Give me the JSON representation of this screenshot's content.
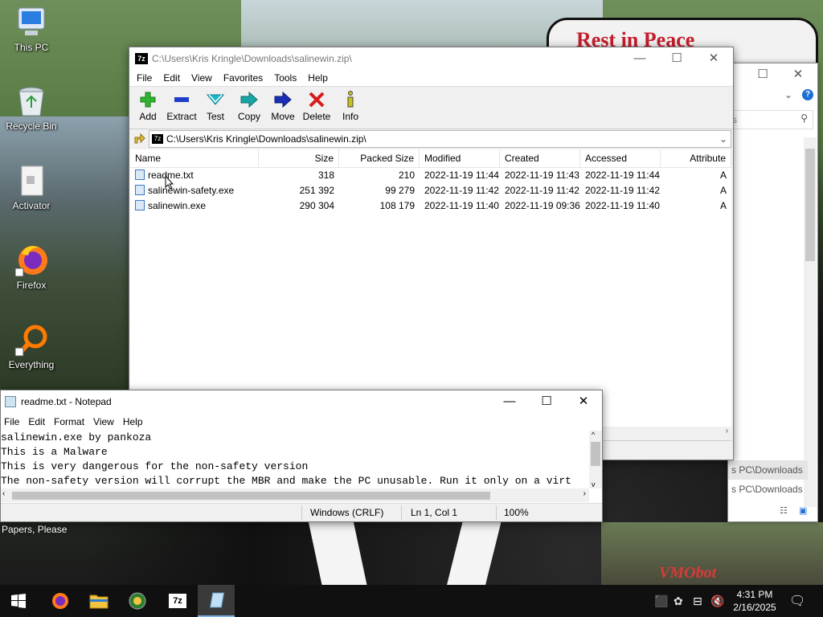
{
  "desktop": {
    "sign_text": "Rest in Peace",
    "wallpaper_mark": "VMObot",
    "icons": [
      {
        "label": "This PC",
        "icon": "this-pc-icon"
      },
      {
        "label": "Recycle Bin",
        "icon": "recycle-bin-icon"
      },
      {
        "label": "Activator",
        "icon": "activator-icon"
      },
      {
        "label": "Firefox",
        "icon": "firefox-icon"
      },
      {
        "label": "Everything",
        "icon": "everything-icon"
      }
    ],
    "papers_label": "Papers, Please"
  },
  "explorer": {
    "rows": [
      "s PC\\Downloads",
      "s PC\\Downloads"
    ],
    "search_placeholder": "s"
  },
  "zip": {
    "title": "C:\\Users\\Kris Kringle\\Downloads\\salinewin.zip\\",
    "menu": [
      "File",
      "Edit",
      "View",
      "Favorites",
      "Tools",
      "Help"
    ],
    "toolbar": [
      {
        "label": "Add",
        "icon": "add-icon",
        "color": "#2db52d"
      },
      {
        "label": "Extract",
        "icon": "extract-icon",
        "color": "#1e3ec9"
      },
      {
        "label": "Test",
        "icon": "test-icon",
        "color": "#19b7c7"
      },
      {
        "label": "Copy",
        "icon": "copy-icon",
        "color": "#17a5a5"
      },
      {
        "label": "Move",
        "icon": "move-icon",
        "color": "#1a2eb5"
      },
      {
        "label": "Delete",
        "icon": "delete-icon",
        "color": "#d81b1b"
      },
      {
        "label": "Info",
        "icon": "info-icon",
        "color": "#c9c21c"
      }
    ],
    "address": "C:\\Users\\Kris Kringle\\Downloads\\salinewin.zip\\",
    "columns": [
      "Name",
      "Size",
      "Packed Size",
      "Modified",
      "Created",
      "Accessed",
      "Attribute"
    ],
    "files": [
      {
        "name": "readme.txt",
        "size": "318",
        "packed": "210",
        "modified": "2022-11-19 11:44",
        "created": "2022-11-19 11:43",
        "accessed": "2022-11-19 11:44",
        "attr": "A"
      },
      {
        "name": "salinewin-safety.exe",
        "size": "251 392",
        "packed": "99 279",
        "modified": "2022-11-19 11:42",
        "created": "2022-11-19 11:42",
        "accessed": "2022-11-19 11:42",
        "attr": "A"
      },
      {
        "name": "salinewin.exe",
        "size": "290 304",
        "packed": "108 179",
        "modified": "2022-11-19 11:40",
        "created": "2022-11-19 09:36",
        "accessed": "2022-11-19 11:40",
        "attr": "A"
      }
    ]
  },
  "notepad": {
    "title": "readme.txt - Notepad",
    "menu": [
      "File",
      "Edit",
      "Format",
      "View",
      "Help"
    ],
    "lines": [
      "salinewin.exe by pankoza",
      "This is a Malware",
      "This is very dangerous for the non-safety version",
      "The non-safety version will corrupt the MBR and make the PC unusable. Run it only on a virt"
    ],
    "status": {
      "eol": "Windows (CRLF)",
      "position": "Ln 1, Col 1",
      "zoom": "100%"
    }
  },
  "taskbar": {
    "apps": [
      {
        "name": "start",
        "icon": "windows-start-icon"
      },
      {
        "name": "firefox",
        "icon": "firefox-icon"
      },
      {
        "name": "file-explorer",
        "icon": "folder-icon"
      },
      {
        "name": "everything",
        "icon": "everything-icon"
      },
      {
        "name": "7-zip",
        "icon": "7zip-icon"
      },
      {
        "name": "notepad",
        "icon": "notepad-icon"
      }
    ],
    "time": "4:31 PM",
    "date": "2/16/2025"
  }
}
